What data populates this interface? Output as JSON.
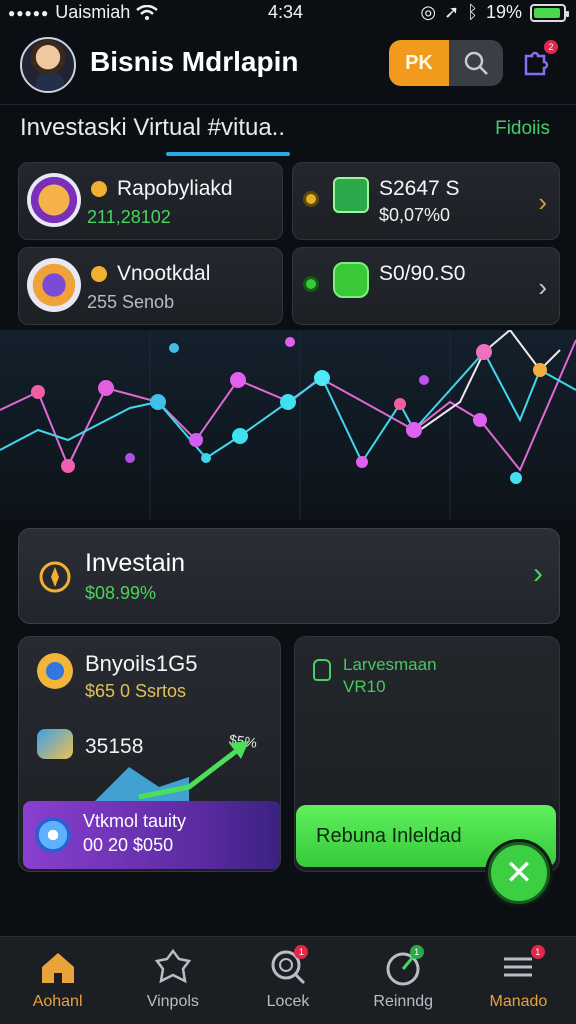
{
  "status_bar": {
    "carrier": "Uaismiah",
    "time": "4:34",
    "battery": "19%",
    "battery_fraction": 0.19
  },
  "header": {
    "title": "Bisnis Mdrlapin",
    "pk_label": "PK",
    "notification_count": "2"
  },
  "section": {
    "title": "Investaski Virtual #vitua..",
    "link": "Fidoiis"
  },
  "cards": [
    {
      "title": "Rapobyliakd",
      "value": "211,28102"
    },
    {
      "title": "S2647 S",
      "value": "$0,07%0"
    },
    {
      "title": "Vnootkdal",
      "value": "255 Senob"
    },
    {
      "title": "S0/90.S0",
      "value": ""
    }
  ],
  "invest": {
    "title": "Investain",
    "value": "$08.99%"
  },
  "left_panel": {
    "title": "Bnyoils1G5",
    "subtitle": "$65 0 Ssrtos",
    "value": "35158",
    "percent": "$5%",
    "promo_line1": "Vtkmol tauity",
    "promo_line2": "00 20 $050"
  },
  "right_panel": {
    "line1": "Larvesmaan",
    "line2": "VR10",
    "cta_label": "Rebuna Inleldad"
  },
  "nav": [
    {
      "label": "Aohanl",
      "icon": "home-icon",
      "active": true
    },
    {
      "label": "Vinpols",
      "icon": "puzzle-icon",
      "badge": ""
    },
    {
      "label": "Locek",
      "icon": "search-icon",
      "badge": "1"
    },
    {
      "label": "Reinndg",
      "icon": "gauge-icon",
      "badge": "1"
    },
    {
      "label": "Manado",
      "icon": "menu-icon",
      "badge": "1"
    }
  ],
  "colors": {
    "accent_green": "#48d462",
    "accent_orange": "#f29a1c",
    "background": "#0b0f14"
  }
}
